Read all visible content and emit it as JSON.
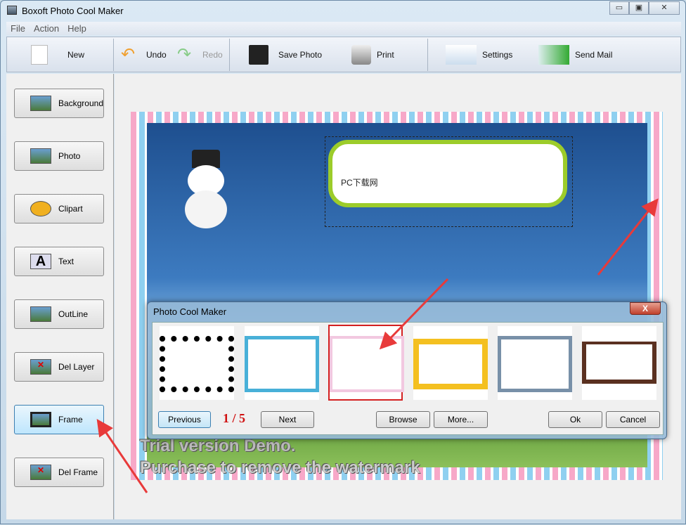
{
  "window": {
    "title": "Boxoft Photo Cool Maker",
    "minimize": "▭",
    "maximize": "▣",
    "close": "✕"
  },
  "menu": [
    "File",
    "Action",
    "Help"
  ],
  "toolbar": {
    "new": "New",
    "undo": "Undo",
    "redo": "Redo",
    "save": "Save Photo",
    "print": "Print",
    "settings": "Settings",
    "send_mail": "Send Mail"
  },
  "sidebar": [
    "Background",
    "Photo",
    "Clipart",
    "Text",
    "OutLine",
    "Del Layer",
    "Frame",
    "Del Frame"
  ],
  "canvas": {
    "bubble_text": "PC下载网",
    "watermark_line1": "Trial version Demo.",
    "watermark_line2": "Purchase to remove the watermark"
  },
  "dialog": {
    "title": "Photo Cool Maker",
    "close": "X",
    "previous": "Previous",
    "page": "1 / 5",
    "next": "Next",
    "browse": "Browse",
    "more": "More...",
    "ok": "Ok",
    "cancel": "Cancel",
    "selected_index": 2
  },
  "colors": {
    "accent_red": "#d42020",
    "arrow": "#e83a3a"
  }
}
